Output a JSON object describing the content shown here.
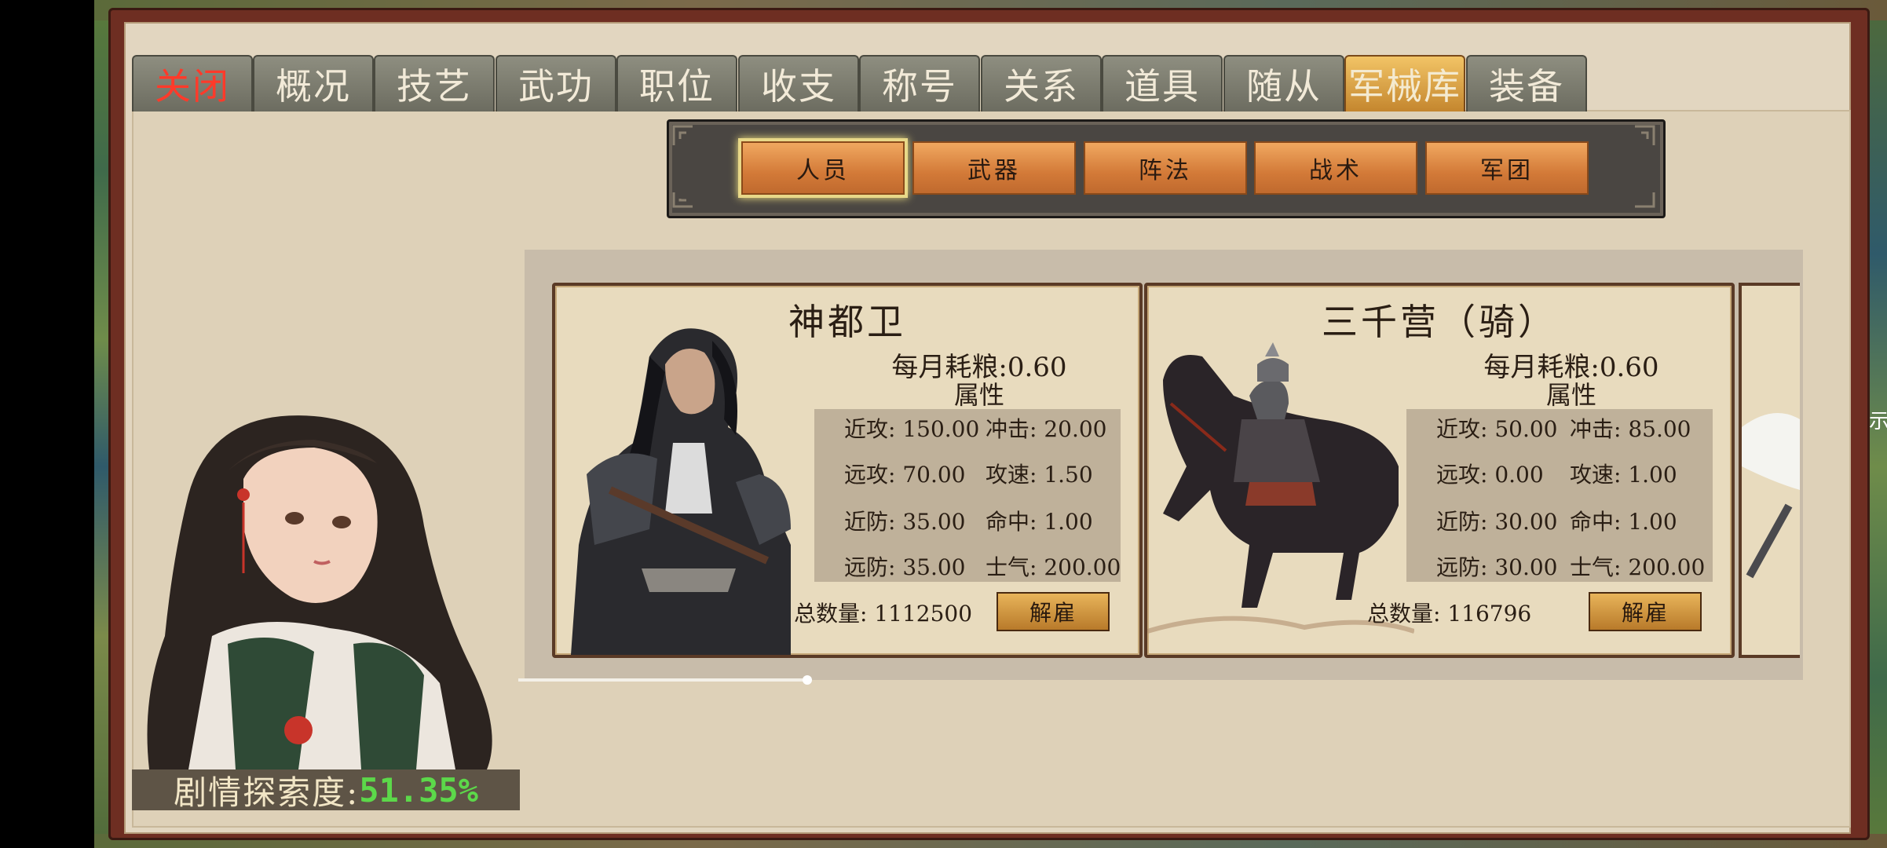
{
  "tabs": [
    {
      "label": "关闭",
      "state": "close"
    },
    {
      "label": "概况",
      "state": "normal"
    },
    {
      "label": "技艺",
      "state": "normal"
    },
    {
      "label": "武功",
      "state": "normal"
    },
    {
      "label": "职位",
      "state": "normal"
    },
    {
      "label": "收支",
      "state": "normal"
    },
    {
      "label": "称号",
      "state": "normal"
    },
    {
      "label": "关系",
      "state": "normal"
    },
    {
      "label": "道具",
      "state": "normal"
    },
    {
      "label": "随从",
      "state": "normal"
    },
    {
      "label": "军械库",
      "state": "active"
    },
    {
      "label": "装备",
      "state": "normal"
    }
  ],
  "subnav": {
    "items": [
      "人员",
      "武器",
      "阵法",
      "战术",
      "军团"
    ],
    "active_index": 0
  },
  "cards": [
    {
      "name": "神都卫",
      "upkeep": "每月耗粮:0.60",
      "attr_label": "属性",
      "stats": [
        [
          "近攻: 150.00",
          "冲击: 20.00"
        ],
        [
          "远攻: 70.00",
          "攻速: 1.50"
        ],
        [
          "近防: 35.00",
          "命中: 1.00"
        ],
        [
          "远防: 35.00",
          "士气: 200.00"
        ]
      ],
      "count_label": "总数量:",
      "count_value": "1112500",
      "dismiss_label": "解雇",
      "portrait": "armored-warrior"
    },
    {
      "name": "三千营（骑）",
      "upkeep": "每月耗粮:0.60",
      "attr_label": "属性",
      "stats": [
        [
          "近攻: 50.00",
          "冲击: 85.00"
        ],
        [
          "远攻: 0.00",
          "攻速: 1.00"
        ],
        [
          "近防: 30.00",
          "命中: 1.00"
        ],
        [
          "远防: 30.00",
          "士气: 200.00"
        ]
      ],
      "count_label": "总数量:",
      "count_value": "116796",
      "dismiss_label": "解雇",
      "portrait": "cavalry-rider"
    }
  ],
  "story_progress": {
    "label": "剧情探索度:",
    "value": "51.35%"
  },
  "edge_text": "示",
  "colors": {
    "frame": "#6e2e22",
    "parchment": "#e2d6c0",
    "tab_normal": "#7c7c70",
    "tab_active": "#e0a648",
    "close_red": "#ff3a2a",
    "subbtn": "#d98a44",
    "progress_green": "#5cd84a"
  }
}
